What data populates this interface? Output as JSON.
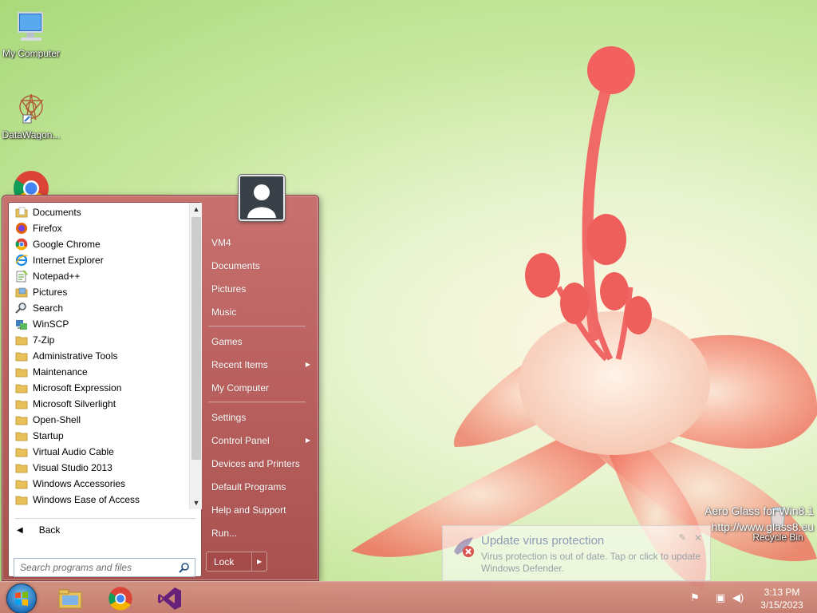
{
  "desktop": {
    "icons": [
      {
        "label": "My Computer"
      },
      {
        "label": "DataWagon..."
      },
      {
        "label": "Recycle Bin"
      }
    ],
    "watermark": {
      "line1": "Aero Glass for Win8.1",
      "line2": "http://www.glass8.eu"
    }
  },
  "start_menu": {
    "programs": [
      {
        "label": "Documents",
        "icon": "documents-icon"
      },
      {
        "label": "Firefox",
        "icon": "firefox-icon"
      },
      {
        "label": "Google Chrome",
        "icon": "chrome-icon"
      },
      {
        "label": "Internet Explorer",
        "icon": "ie-icon"
      },
      {
        "label": "Notepad++",
        "icon": "notepadpp-icon"
      },
      {
        "label": "Pictures",
        "icon": "pictures-icon"
      },
      {
        "label": "Search",
        "icon": "search-icon"
      },
      {
        "label": "WinSCP",
        "icon": "winscp-icon"
      },
      {
        "label": "7-Zip",
        "icon": "folder-icon"
      },
      {
        "label": "Administrative Tools",
        "icon": "folder-icon"
      },
      {
        "label": "Maintenance",
        "icon": "folder-icon"
      },
      {
        "label": "Microsoft Expression",
        "icon": "folder-icon"
      },
      {
        "label": "Microsoft Silverlight",
        "icon": "folder-icon"
      },
      {
        "label": "Open-Shell",
        "icon": "folder-icon"
      },
      {
        "label": "Startup",
        "icon": "folder-icon"
      },
      {
        "label": "Virtual Audio Cable",
        "icon": "folder-icon"
      },
      {
        "label": "Visual Studio 2013",
        "icon": "folder-icon"
      },
      {
        "label": "Windows Accessories",
        "icon": "folder-icon"
      },
      {
        "label": "Windows Ease of Access",
        "icon": "folder-icon"
      }
    ],
    "back_label": "Back",
    "search_placeholder": "Search programs and files",
    "right_items": {
      "user": "VM4",
      "documents": "Documents",
      "pictures": "Pictures",
      "music": "Music",
      "games": "Games",
      "recent_items": "Recent Items",
      "my_computer": "My Computer",
      "settings": "Settings",
      "control_panel": "Control Panel",
      "devices_printers": "Devices and Printers",
      "default_programs": "Default Programs",
      "help_support": "Help and Support",
      "run": "Run..."
    },
    "lock_label": "Lock"
  },
  "notification": {
    "title": "Update virus protection",
    "body": "Virus protection is out of date. Tap or click to update Windows Defender."
  },
  "taskbar": {
    "clock_time": "3:13 PM",
    "clock_date": "3/15/2023"
  }
}
